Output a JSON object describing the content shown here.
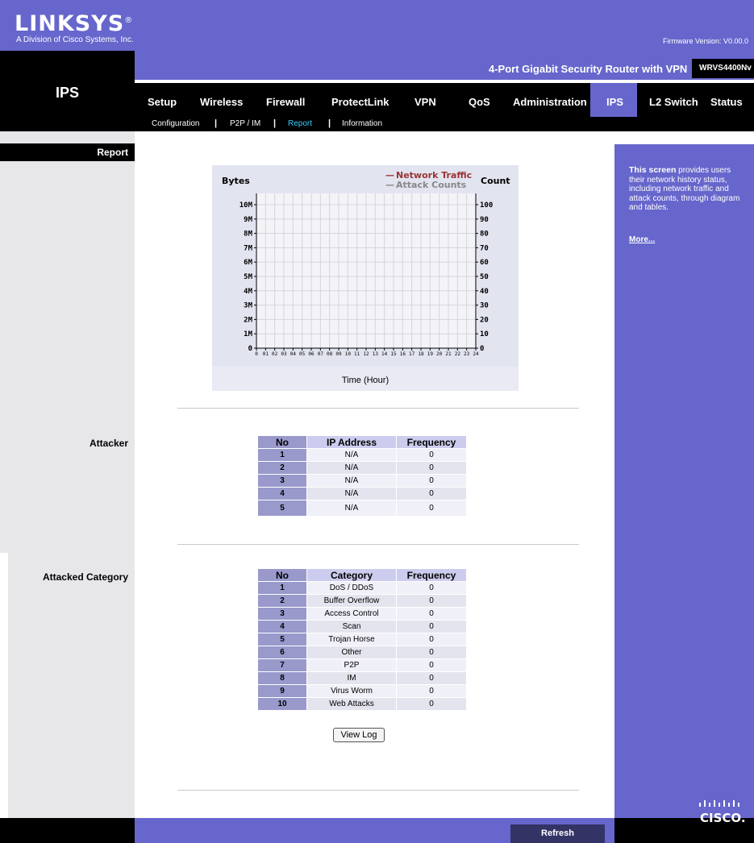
{
  "header": {
    "logo": "LINKSYS",
    "logo_tagline": "A Division of Cisco Systems, Inc.",
    "firmware": "Firmware Version: V0.00.0",
    "model_name": "4-Port Gigabit Security Router with VPN",
    "model_number": "WRVS4400Nv",
    "section_title": "IPS"
  },
  "nav": {
    "tabs": [
      {
        "label": "Setup"
      },
      {
        "label": "Wireless"
      },
      {
        "label": "Firewall"
      },
      {
        "label": "ProtectLink"
      },
      {
        "label": "VPN"
      },
      {
        "label": "QoS"
      },
      {
        "label": "Administration"
      },
      {
        "label": "IPS",
        "active": true
      },
      {
        "label": "L2 Switch"
      },
      {
        "label": "Status"
      }
    ],
    "subtabs": [
      {
        "label": "Configuration"
      },
      {
        "label": "P2P / IM"
      },
      {
        "label": "Report",
        "active": true
      },
      {
        "label": "Information"
      }
    ]
  },
  "left": {
    "report_label": "Report",
    "attacker_label": "Attacker",
    "attacked_category_label": "Attacked Category"
  },
  "chart_data": {
    "type": "line",
    "left_axis_label": "Bytes",
    "right_axis_label": "Count",
    "xlabel": "Time (Hour)",
    "x": [
      "0",
      "01",
      "02",
      "03",
      "04",
      "05",
      "06",
      "07",
      "08",
      "09",
      "10",
      "11",
      "12",
      "13",
      "14",
      "15",
      "16",
      "17",
      "18",
      "19",
      "20",
      "21",
      "22",
      "23",
      "24"
    ],
    "left_ticks": [
      "0",
      "1M",
      "2M",
      "3M",
      "4M",
      "5M",
      "6M",
      "7M",
      "8M",
      "9M",
      "10M"
    ],
    "right_ticks": [
      "0",
      "10",
      "20",
      "30",
      "40",
      "50",
      "60",
      "70",
      "80",
      "90",
      "100"
    ],
    "series": [
      {
        "name": "Network Traffic",
        "color": "#993333",
        "values": []
      },
      {
        "name": "Attack Counts",
        "color": "#888888",
        "values": []
      }
    ],
    "grid": true
  },
  "attacker_table": {
    "headers": [
      "No",
      "IP Address",
      "Frequency"
    ],
    "rows": [
      {
        "no": "1",
        "ip": "N/A",
        "freq": "0"
      },
      {
        "no": "2",
        "ip": "N/A",
        "freq": "0"
      },
      {
        "no": "3",
        "ip": "N/A",
        "freq": "0"
      },
      {
        "no": "4",
        "ip": "N/A",
        "freq": "0"
      },
      {
        "no": "5",
        "ip": "N/A",
        "freq": "0"
      }
    ]
  },
  "category_table": {
    "headers": [
      "No",
      "Category",
      "Frequency"
    ],
    "rows": [
      {
        "no": "1",
        "category": "DoS / DDoS",
        "freq": "0"
      },
      {
        "no": "2",
        "category": "Buffer Overflow",
        "freq": "0"
      },
      {
        "no": "3",
        "category": "Access Control",
        "freq": "0"
      },
      {
        "no": "4",
        "category": "Scan",
        "freq": "0"
      },
      {
        "no": "5",
        "category": "Trojan Horse",
        "freq": "0"
      },
      {
        "no": "6",
        "category": "Other",
        "freq": "0"
      },
      {
        "no": "7",
        "category": "P2P",
        "freq": "0"
      },
      {
        "no": "8",
        "category": "IM",
        "freq": "0"
      },
      {
        "no": "9",
        "category": "Virus Worm",
        "freq": "0"
      },
      {
        "no": "10",
        "category": "Web Attacks",
        "freq": "0"
      }
    ]
  },
  "view_log_label": "View Log",
  "help": {
    "lead": "This screen",
    "body": "provides users their network history status, including network traffic and attack counts, through diagram and tables.",
    "more": "More..."
  },
  "footer": {
    "refresh_label": "Refresh",
    "brand": "CISCO."
  }
}
